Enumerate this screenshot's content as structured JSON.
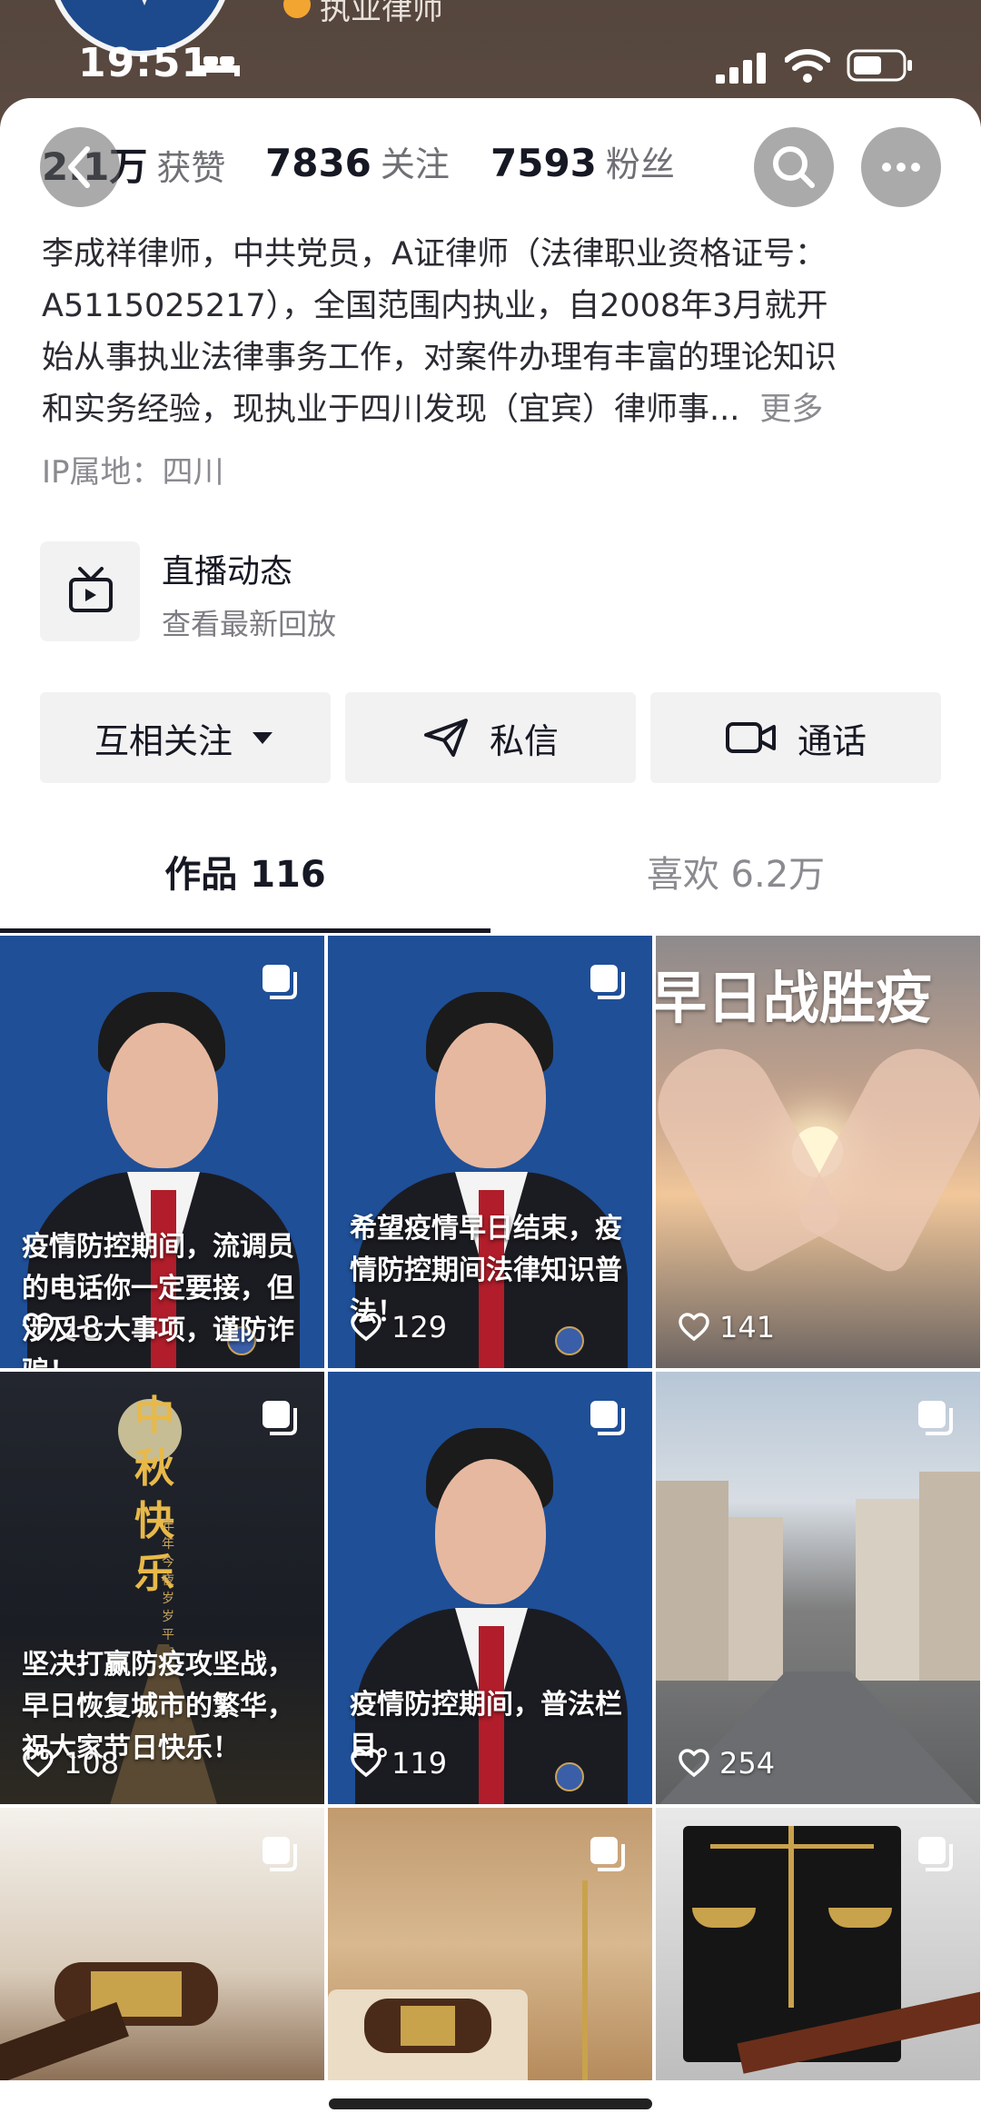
{
  "status_bar": {
    "time": "19:51",
    "icons": [
      "bed-icon",
      "signal-icon",
      "wifi-icon",
      "battery-icon"
    ]
  },
  "profile_header": {
    "name_partial": "执业律师"
  },
  "stats": [
    {
      "value": "2.1万",
      "label": "获赞"
    },
    {
      "value": "7836",
      "label": "关注"
    },
    {
      "value": "7593",
      "label": "粉丝"
    }
  ],
  "bio": {
    "lines": [
      "李成祥律师，中共党员，A证律师（法律职业资格证号：",
      "A5115025217），全国范围内执业，自2008年3月就开",
      "始从事执业法律事务工作，对案件办理有丰富的理论知识",
      "和实务经验，现执业于四川发现（宜宾）律师事..."
    ],
    "more": "更多",
    "ip": "IP属地：四川"
  },
  "live": {
    "title": "直播动态",
    "subtitle": "查看最新回放"
  },
  "actions": {
    "follow": "互相关注",
    "message": "私信",
    "call": "通话"
  },
  "tabs": [
    {
      "label": "作品 116",
      "active": true
    },
    {
      "label": "喜欢 6.2万",
      "active": false
    }
  ],
  "grid": [
    {
      "caption": "疫情防控期间，流调员的电话你一定要接，但涉及七大事项，谨防诈骗！",
      "likes": "18",
      "multi": true,
      "kind": "portrait"
    },
    {
      "caption": "希望疫情早日结束，疫情防控期间法律知识普法！",
      "likes": "129",
      "multi": true,
      "kind": "portrait"
    },
    {
      "caption": "早日战胜疫",
      "likes": "141",
      "multi": false,
      "kind": "hands"
    },
    {
      "caption": "坚决打赢防疫攻坚战，早日恢复城市的繁华，祝大家节日快乐！",
      "likes": "108",
      "multi": true,
      "kind": "moon",
      "title": "中秋快乐",
      "subtitle": "年年今夜 岁岁平安"
    },
    {
      "caption": "疫情防控期间，普法栏目。",
      "likes": "119",
      "multi": true,
      "kind": "portrait"
    },
    {
      "caption": "",
      "likes": "254",
      "multi": true,
      "kind": "street"
    },
    {
      "caption": "",
      "likes": "",
      "multi": true,
      "kind": "gavel"
    },
    {
      "caption": "",
      "likes": "",
      "multi": true,
      "kind": "gavel2"
    },
    {
      "caption": "",
      "likes": "",
      "multi": true,
      "kind": "scales"
    }
  ]
}
